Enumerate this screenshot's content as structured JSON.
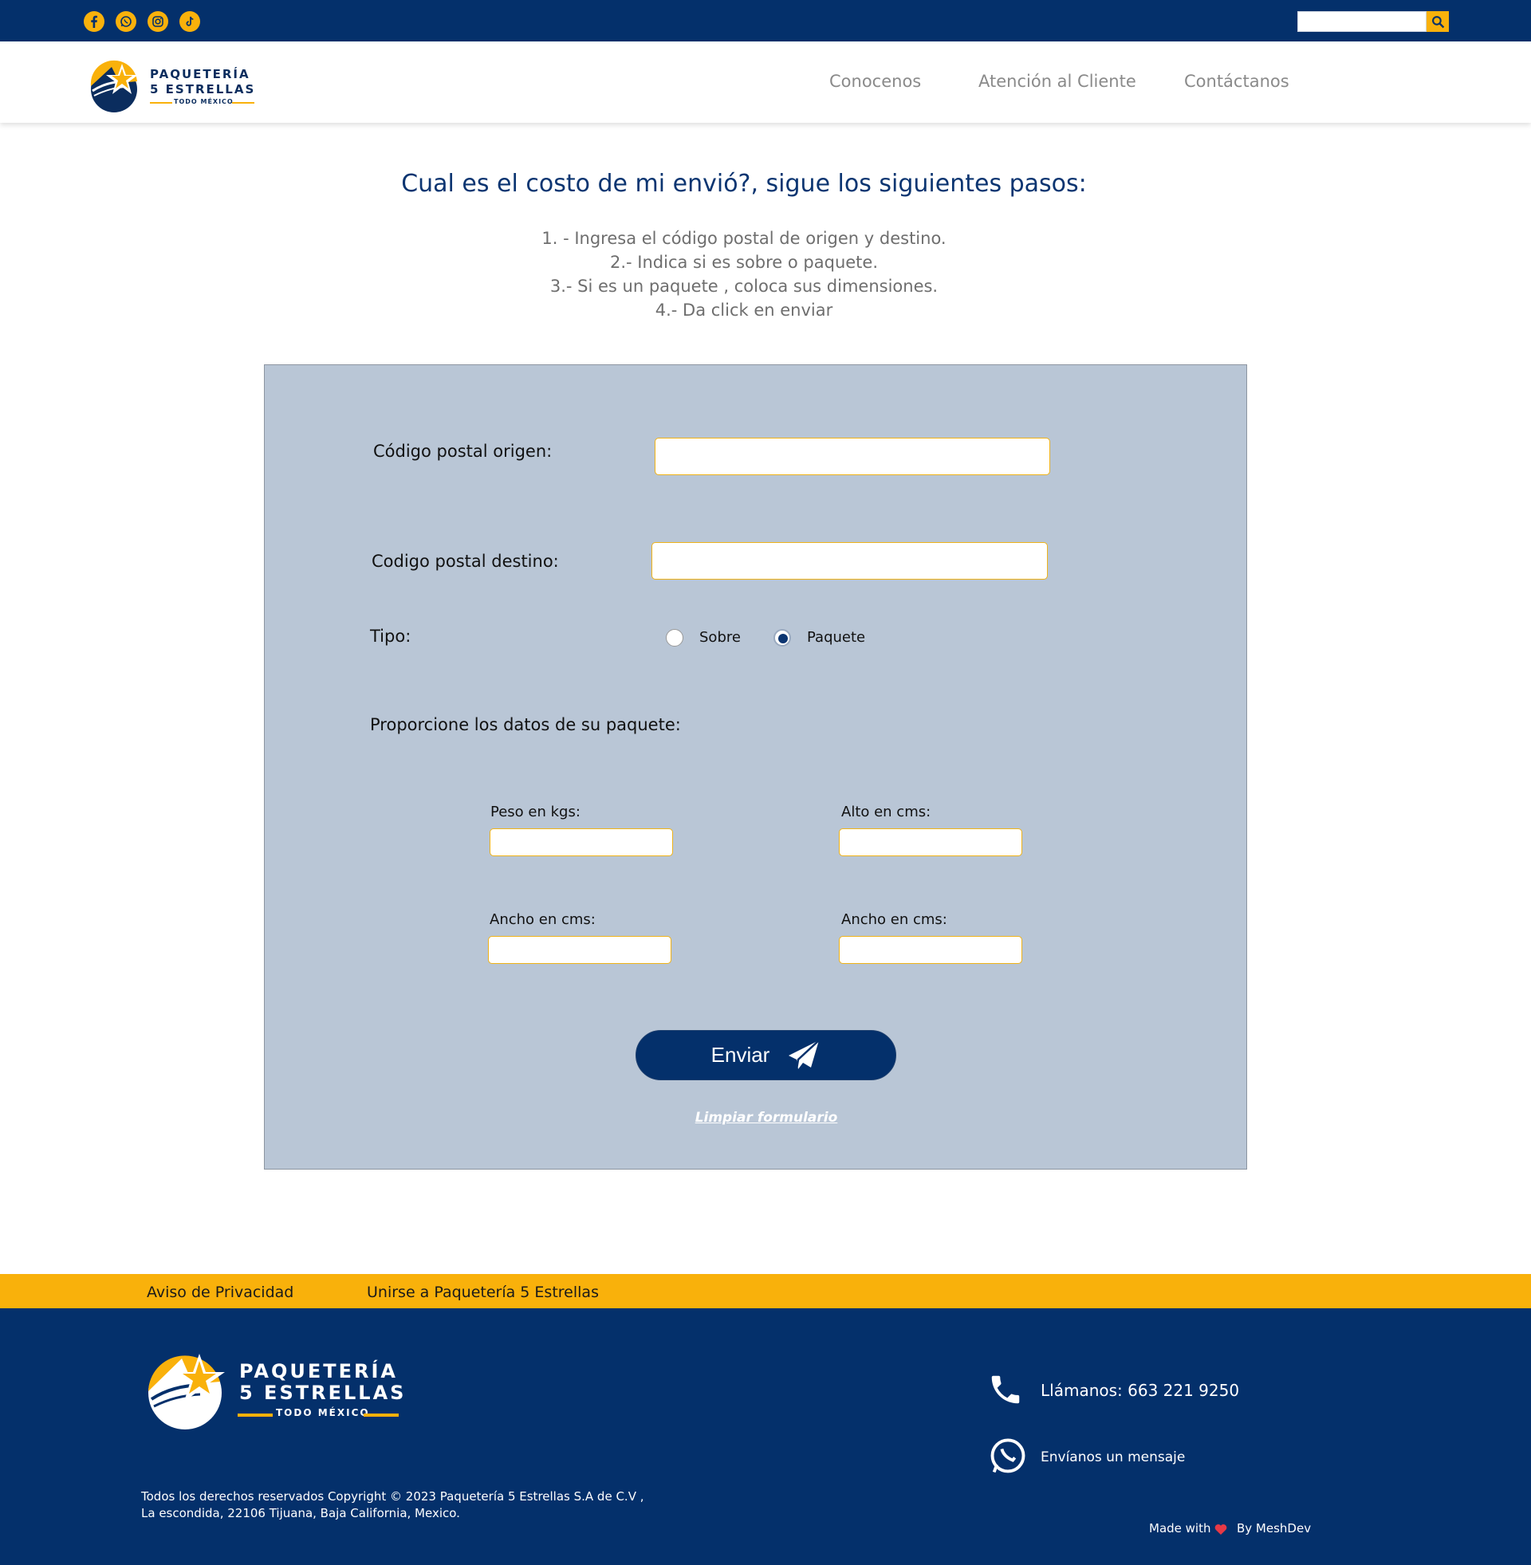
{
  "colors": {
    "navy": "#04306b",
    "gold": "#f9b10b",
    "panel": "#b9c6d6"
  },
  "topbar": {
    "social_icons": [
      "facebook-icon",
      "whatsapp-icon",
      "instagram-icon",
      "tiktok-icon"
    ],
    "search": {
      "placeholder": "",
      "icon": "search-icon"
    }
  },
  "header": {
    "logo": {
      "line1": "PAQUETERÍA",
      "line2": "5 ESTRELLAS",
      "line3": "TODO MÉXICO"
    },
    "nav": [
      "Conocenos",
      "Atención al Cliente",
      "Contáctanos"
    ]
  },
  "main": {
    "title": "Cual es el costo de mi envió?, sigue los siguientes pasos:",
    "steps": [
      "1. -  Ingresa el código postal de origen y destino.",
      "2.-  Indica si es sobre o paquete.",
      "3.-  Si es un paquete , coloca sus dimensiones.",
      "4.- Da click en enviar"
    ]
  },
  "form": {
    "origin_label": "Código postal origen:",
    "origin_value": "",
    "dest_label": "Codigo postal destino:",
    "dest_value": "",
    "type_label": "Tipo:",
    "type_options": [
      "Sobre",
      "Paquete"
    ],
    "type_selected": "Paquete",
    "package_heading": "Proporcione los datos de su paquete:",
    "weight_label": "Peso en kgs:",
    "height_label": "Alto en cms:",
    "width_label": "Ancho en cms:",
    "width2_label": "Ancho en cms:",
    "submit_label": "Enviar",
    "clear_label": "Limpiar formulario"
  },
  "footer": {
    "links": [
      "Aviso de Privacidad",
      "Unirse a Paquetería 5 Estrellas"
    ],
    "logo": {
      "line1": "PAQUETERÍA",
      "line2": "5 ESTRELLAS",
      "line3": "TODO MÉXICO"
    },
    "phone_text": "Llámanos: 663 221 9250",
    "message_text": "Envíanos un mensaje",
    "copyright_line1": "Todos los derechos reservados Copyright © 2023 Paquetería 5  Estrellas S.A de C.V ,",
    "copyright_line2": "La escondida, 22106 Tijuana, Baja California, Mexico.",
    "made_with": "Made with",
    "by": "By MeshDev"
  }
}
